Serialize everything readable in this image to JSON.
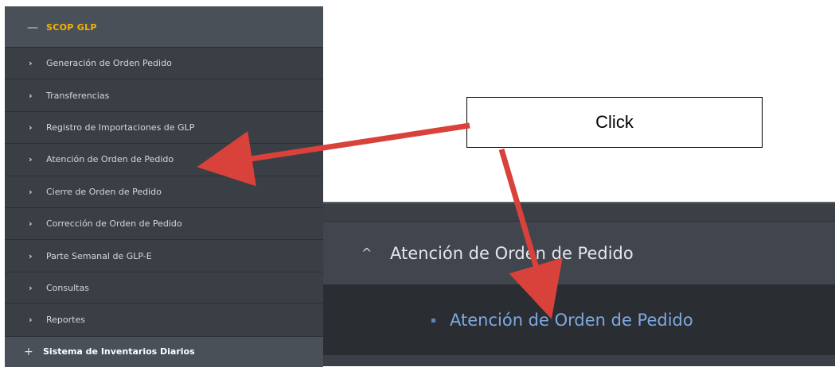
{
  "sidebar": {
    "header": {
      "icon": "minus-icon",
      "title": "SCOP GLP"
    },
    "items": [
      {
        "label": "Generación de Orden Pedido"
      },
      {
        "label": "Transferencias"
      },
      {
        "label": "Registro de Importaciones de GLP"
      },
      {
        "label": "Atención de Orden de Pedido"
      },
      {
        "label": "Cierre de Orden de Pedido"
      },
      {
        "label": "Corrección de Orden de Pedido"
      },
      {
        "label": "Parte Semanal de GLP-E"
      },
      {
        "label": "Consultas"
      },
      {
        "label": "Reportes"
      }
    ],
    "footer": {
      "icon": "plus-icon",
      "label": "Sistema de Inventarios Diarios"
    }
  },
  "callout": {
    "text": "Click"
  },
  "zoom": {
    "parent_label": "Atención de Orden de Pedido",
    "child_label": "Atención de Orden de Pedido"
  },
  "colors": {
    "sidebar_bg": "#3a3f46",
    "header_title": "#f4b400",
    "arrow": "#d9413b",
    "child_link": "#7fa8e0"
  }
}
